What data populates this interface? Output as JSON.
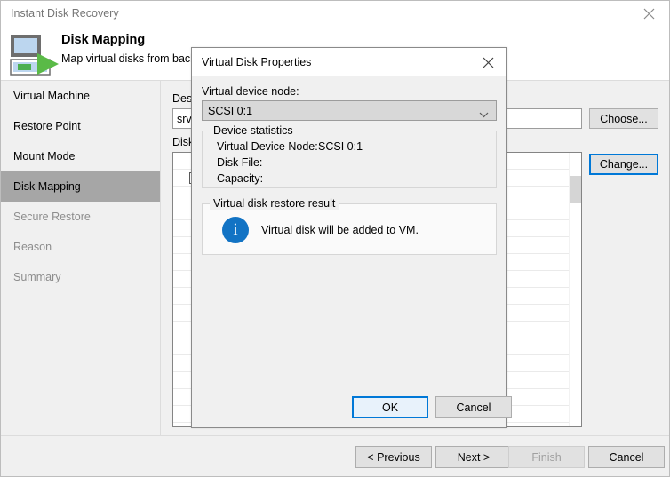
{
  "window": {
    "title": "Instant Disk Recovery",
    "close_icon": "close-icon"
  },
  "header": {
    "title": "Disk Mapping",
    "subtitle": "Map virtual disks from backup to datastores.",
    "icon": "instant-disk-recovery-icon"
  },
  "sidebar": {
    "items": [
      {
        "label": "Virtual Machine",
        "state": "normal"
      },
      {
        "label": "Restore Point",
        "state": "normal"
      },
      {
        "label": "Mount Mode",
        "state": "normal"
      },
      {
        "label": "Disk Mapping",
        "state": "selected"
      },
      {
        "label": "Secure Restore",
        "state": "dim"
      },
      {
        "label": "Reason",
        "state": "dim"
      },
      {
        "label": "Summary",
        "state": "dim"
      }
    ],
    "selected_color": "#a6a6a6"
  },
  "content": {
    "destination_label": "Destination host or cluster:",
    "destination_value": "srv",
    "choose_label": "Choose...",
    "disks_label": "Disks:",
    "change_label": "Change...",
    "change_focus_color": "#0078d7",
    "table_row_count": 16,
    "checked_row_index": 1
  },
  "footer": {
    "previous_label": "< Previous",
    "next_label": "Next >",
    "finish_label": "Finish",
    "finish_enabled": false,
    "cancel_label": "Cancel"
  },
  "dialog": {
    "title": "Virtual Disk Properties",
    "close_icon": "close-icon",
    "device_node_label": "Virtual device node:",
    "device_node_value": "SCSI 0:1",
    "device_node_arrow_icon": "chevron-down-icon",
    "stats_group_label": "Device statistics",
    "stats": [
      {
        "key": "Virtual Device Node:",
        "value": "SCSI 0:1"
      },
      {
        "key": "Disk File:",
        "value": ""
      },
      {
        "key": "Capacity:",
        "value": ""
      }
    ],
    "result_group_label": "Virtual disk restore result",
    "result_icon": "info-icon",
    "result_icon_color": "#1273c4",
    "result_text": "Virtual disk will be added to VM.",
    "ok_label": "OK",
    "cancel_label": "Cancel",
    "ok_focus_color": "#0078d7"
  }
}
